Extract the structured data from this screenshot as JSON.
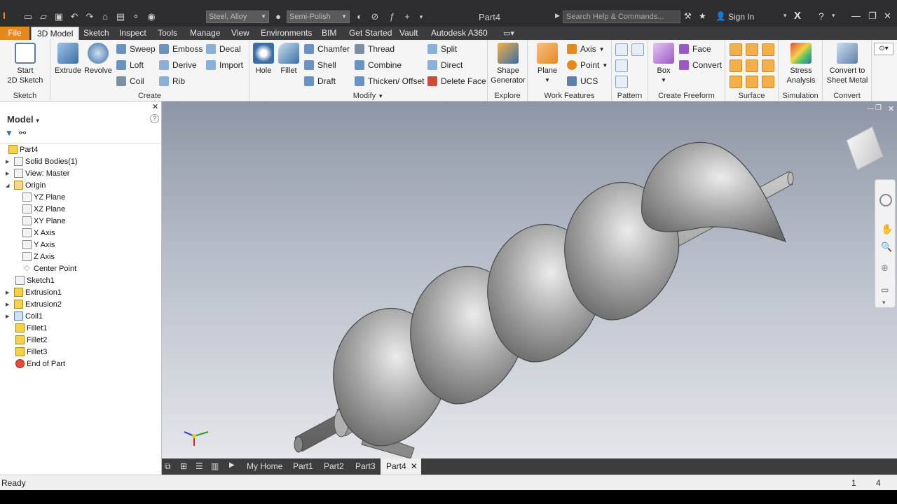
{
  "titlebar": {
    "title": "Part4",
    "material": "Steel, Alloy",
    "appearance": "Semi-Polish",
    "search_placeholder": "Search Help & Commands...",
    "signin": "Sign In"
  },
  "tabs": [
    "File",
    "3D Model",
    "Sketch",
    "Inspect",
    "Tools",
    "Manage",
    "View",
    "Environments",
    "BIM",
    "Get Started",
    "Vault",
    "Autodesk A360"
  ],
  "ribbon": {
    "sketch": {
      "label": "Sketch",
      "start_line1": "Start",
      "start_line2": "2D Sketch"
    },
    "create": {
      "label": "Create",
      "extrude": "Extrude",
      "revolve": "Revolve",
      "sweep": "Sweep",
      "loft": "Loft",
      "coil": "Coil",
      "emboss": "Emboss",
      "derive": "Derive",
      "rib": "Rib",
      "decal": "Decal",
      "import": "Import"
    },
    "modify": {
      "label": "Modify",
      "hole": "Hole",
      "fillet": "Fillet",
      "chamfer": "Chamfer",
      "shell": "Shell",
      "draft": "Draft",
      "thread": "Thread",
      "combine": "Combine",
      "thicken": "Thicken/ Offset",
      "split": "Split",
      "direct": "Direct",
      "delete_face": "Delete Face"
    },
    "explore": {
      "label": "Explore",
      "shape_line1": "Shape",
      "shape_line2": "Generator"
    },
    "work": {
      "label": "Work Features",
      "plane": "Plane",
      "axis": "Axis",
      "point": "Point",
      "ucs": "UCS"
    },
    "pattern": {
      "label": "Pattern"
    },
    "freeform": {
      "label": "Create Freeform",
      "box": "Box",
      "face": "Face",
      "convert": "Convert"
    },
    "surface": {
      "label": "Surface"
    },
    "simulation": {
      "label": "Simulation",
      "stress_line1": "Stress",
      "stress_line2": "Analysis"
    },
    "convert": {
      "label": "Convert",
      "sheet_line1": "Convert to",
      "sheet_line2": "Sheet Metal"
    }
  },
  "browser": {
    "title": "Model",
    "items": [
      "Part4",
      "Solid Bodies(1)",
      "View: Master",
      "Origin",
      "YZ Plane",
      "XZ Plane",
      "XY Plane",
      "X Axis",
      "Y Axis",
      "Z Axis",
      "Center Point",
      "Sketch1",
      "Extrusion1",
      "Extrusion2",
      "Coil1",
      "Fillet1",
      "Fillet2",
      "Fillet3",
      "End of Part"
    ]
  },
  "doctabs": [
    "My Home",
    "Part1",
    "Part2",
    "Part3",
    "Part4"
  ],
  "status": {
    "text": "Ready",
    "val1": "1",
    "val2": "4"
  },
  "colors": {
    "file_tab": "#e7881f",
    "titlebar": "#2d2d30",
    "accent": "#3a6ea5"
  }
}
